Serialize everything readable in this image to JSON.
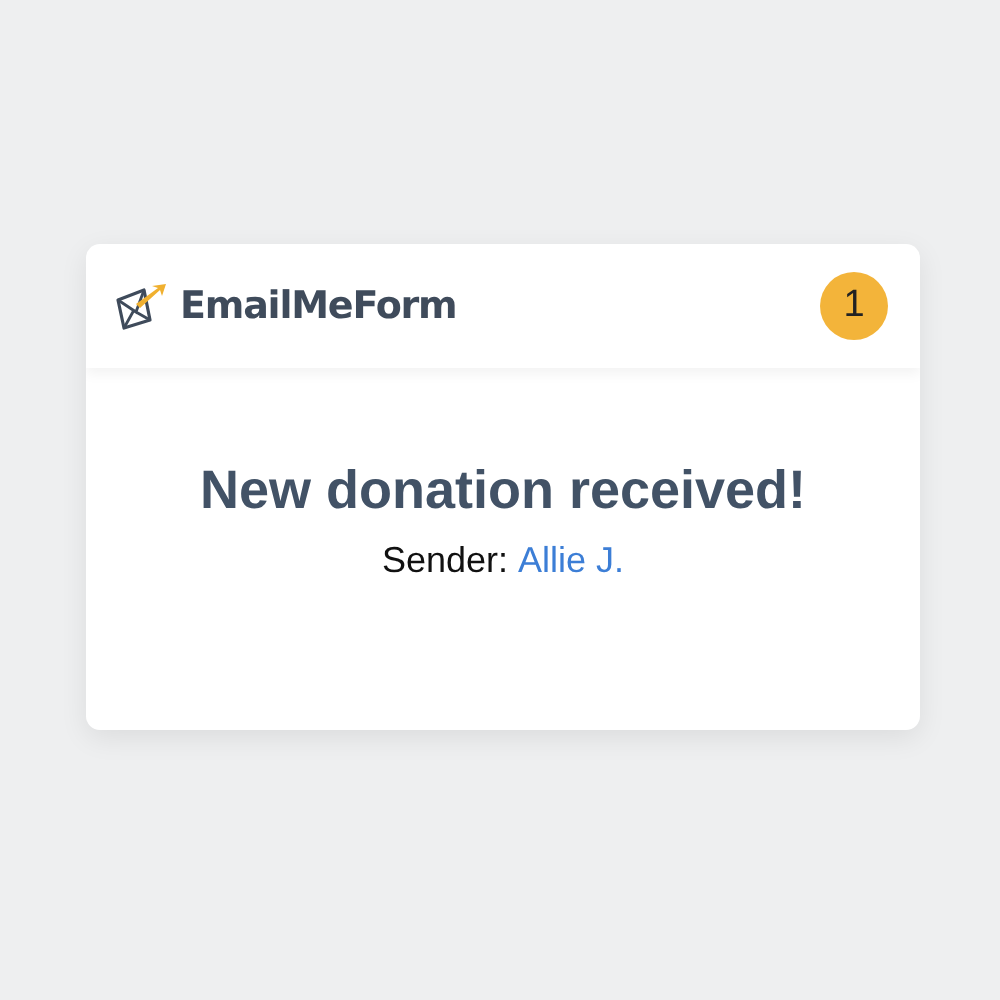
{
  "header": {
    "brand": "EmailMeForm",
    "badge": "1"
  },
  "notification": {
    "title": "New donation received!",
    "sender_label": "Sender:",
    "sender_name": "Allie J."
  }
}
